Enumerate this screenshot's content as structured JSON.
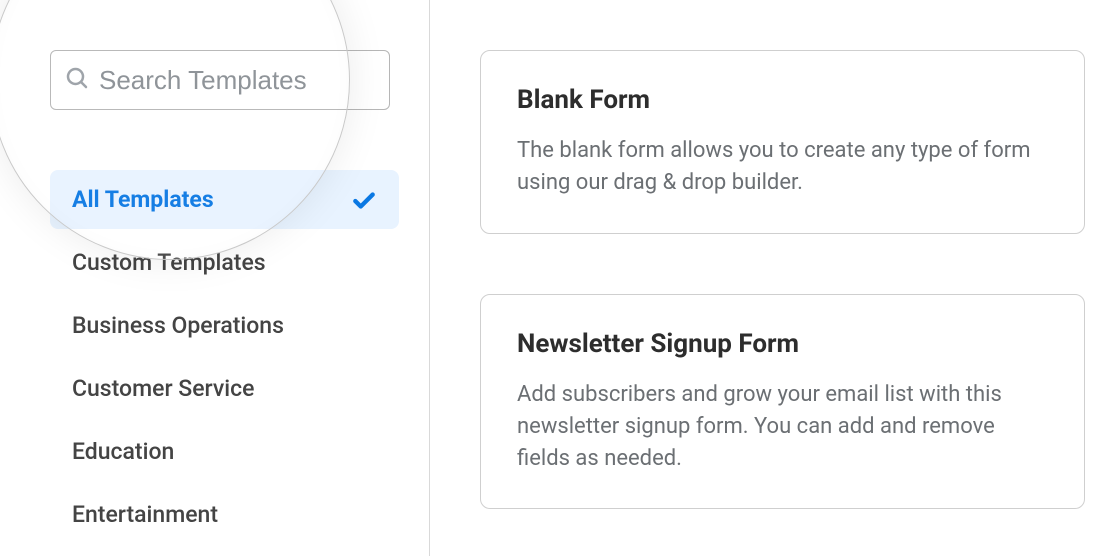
{
  "search": {
    "placeholder": "Search Templates"
  },
  "sidebar": {
    "categories": [
      {
        "label": "All Templates",
        "active": true
      },
      {
        "label": "Custom Templates",
        "active": false
      },
      {
        "label": "Business Operations",
        "active": false
      },
      {
        "label": "Customer Service",
        "active": false
      },
      {
        "label": "Education",
        "active": false
      },
      {
        "label": "Entertainment",
        "active": false
      }
    ]
  },
  "templates": [
    {
      "title": "Blank Form",
      "description": "The blank form allows you to create any type of form using our drag & drop builder."
    },
    {
      "title": "Newsletter Signup Form",
      "description": "Add subscribers and grow your email list with this newsletter signup form. You can add and remove fields as needed."
    }
  ],
  "colors": {
    "accent": "#0a78e3",
    "selected_bg": "#e8f3ff",
    "text_muted": "#6b6f73"
  }
}
